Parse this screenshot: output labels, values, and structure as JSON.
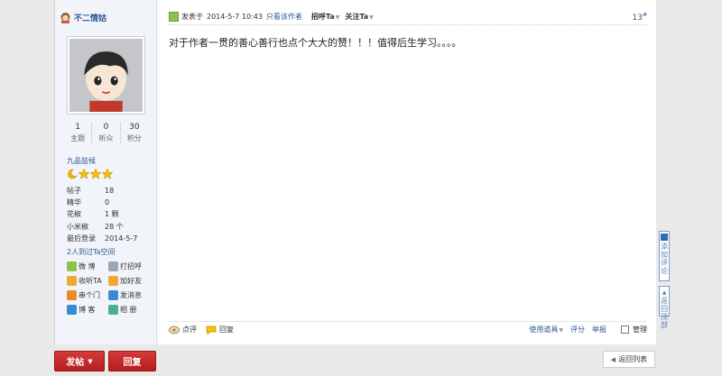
{
  "user": {
    "name": "不二情姑",
    "stats": [
      {
        "value": "1",
        "label": "主题"
      },
      {
        "value": "0",
        "label": "听众"
      },
      {
        "value": "30",
        "label": "积分"
      }
    ],
    "rank": "九品监候",
    "info": [
      {
        "key": "帖子",
        "value": "18"
      },
      {
        "key": "精华",
        "value": "0"
      },
      {
        "key": "花椒",
        "value": "1 颗"
      },
      {
        "key": "小米椒",
        "value": "28 个"
      },
      {
        "key": "最后登录",
        "value": "2014-5-7"
      }
    ],
    "visits": "2人到过Ta空间",
    "actions": [
      {
        "label": "微 博",
        "icon": "weibo-icon",
        "color": "#8bc34a"
      },
      {
        "label": "打招呼",
        "icon": "wave-icon",
        "color": "#9aa7b5"
      },
      {
        "label": "收听TA",
        "icon": "follow-icon",
        "color": "#f0a92e"
      },
      {
        "label": "加好友",
        "icon": "add-friend-icon",
        "color": "#f0a92e"
      },
      {
        "label": "串个门",
        "icon": "home-icon",
        "color": "#e98b2a"
      },
      {
        "label": "发消息",
        "icon": "message-icon",
        "color": "#3a8bd6"
      },
      {
        "label": "博 客",
        "icon": "blog-icon",
        "color": "#3a8bd6"
      },
      {
        "label": "相 册",
        "icon": "album-icon",
        "color": "#4caf8f"
      }
    ]
  },
  "post": {
    "posted_label": "发表于",
    "date": "2014-5-7 10:43",
    "only_author": "只看该作者",
    "greet": "招呼Ta",
    "follow": "关注Ta",
    "floor": "13",
    "floor_suffix": "#",
    "message": "对于作者一贯的善心善行也点个大大的赞！！！值得后生学习。。。。",
    "footer": {
      "comment": "点评",
      "reply": "回复",
      "tools": "使用道具",
      "rate": "评分",
      "report": "举报",
      "manage": "管理"
    }
  },
  "buttons": {
    "post": "发帖",
    "reply": "回复",
    "back": "返回列表"
  },
  "side_tabs": {
    "add_comment": "添加评论",
    "back_top": "返回顶部"
  },
  "colors": {
    "accent_red": "#c62828",
    "link_blue": "#2b5797"
  }
}
